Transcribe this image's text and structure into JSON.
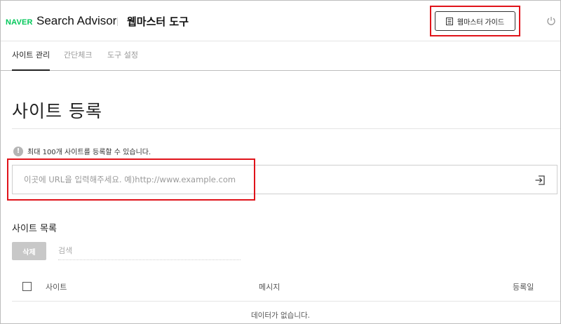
{
  "header": {
    "naver_logo": "NAVER",
    "brand": "Search Advisor",
    "tool_title": "웹마스터 도구",
    "guide_button": "웹마스터 가이드"
  },
  "tabs": [
    {
      "label": "사이트 관리",
      "active": true
    },
    {
      "label": "간단체크",
      "active": false
    },
    {
      "label": "도구 설정",
      "active": false
    }
  ],
  "main": {
    "page_title": "사이트 등록",
    "info_text": "최대 100개 사이트를 등록할 수 있습니다.",
    "info_icon_glyph": "!",
    "url_input": {
      "value": "",
      "placeholder": "이곳에 URL을 입력해주세요. 예)http://www.example.com"
    }
  },
  "site_list": {
    "title": "사이트 목록",
    "delete_button": "삭제",
    "search_placeholder": "검색",
    "columns": [
      "사이트",
      "메시지",
      "등록일"
    ],
    "empty_message": "데이터가 없습니다."
  },
  "icons": {
    "guide": "book-icon",
    "power": "power-icon",
    "submit": "enter-icon",
    "info": "info-icon"
  },
  "colors": {
    "naver_green": "#03c75a",
    "highlight_red": "#e0131a",
    "delete_button_bg": "#c8c8c8"
  }
}
